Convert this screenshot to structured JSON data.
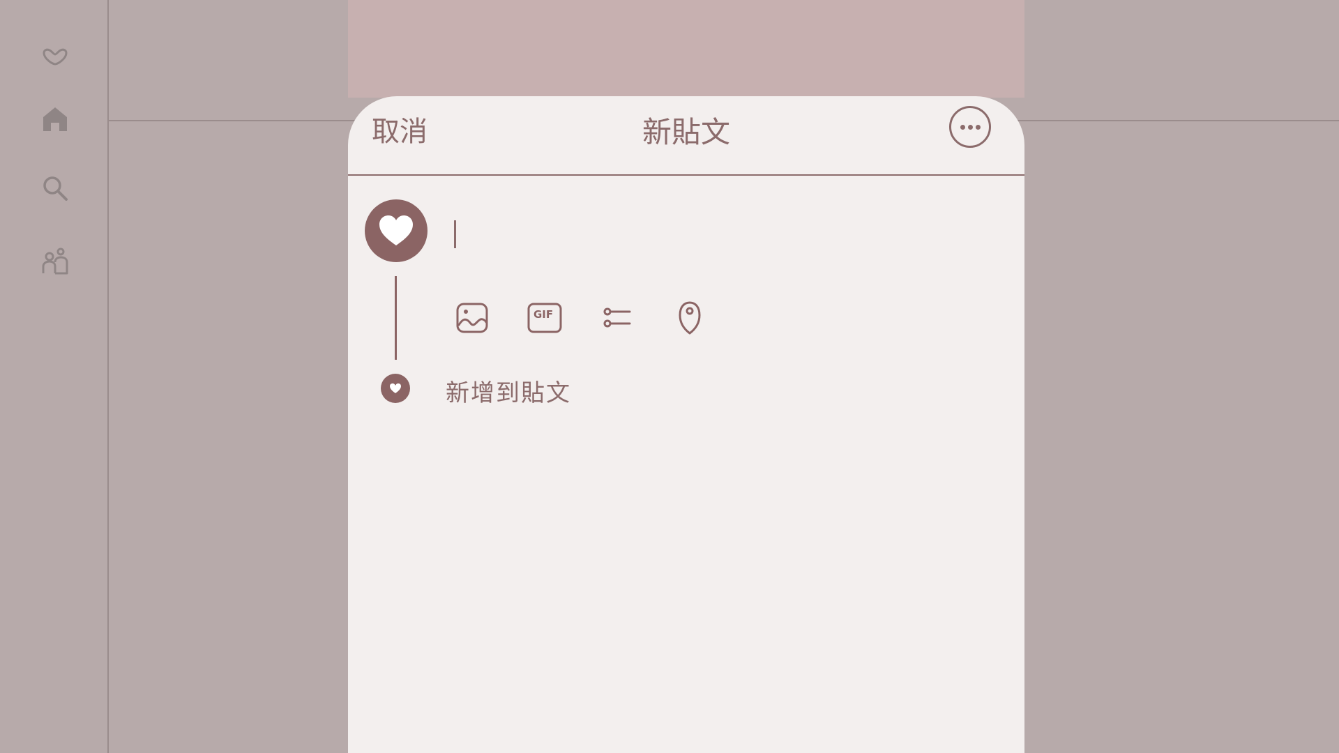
{
  "colors": {
    "background": "#b7aaaa",
    "rail_icon": "#8f8585",
    "modal_bg": "#f3efee",
    "modal_top": "#c7b0b0",
    "accent": "#8b6464"
  },
  "rail": {
    "icons": [
      "logo-heart-icon",
      "home-icon",
      "search-icon",
      "people-icon"
    ]
  },
  "modal": {
    "cancel_label": "取消",
    "title": "新貼文",
    "more_icon": "more-dots-icon",
    "compose": {
      "avatar_icon": "heart-icon",
      "attachments": [
        "image-icon",
        "gif-icon",
        "poll-icon",
        "location-pin-icon"
      ],
      "gif_label": "GIF",
      "add_to_post_label": "新增到貼文"
    }
  }
}
